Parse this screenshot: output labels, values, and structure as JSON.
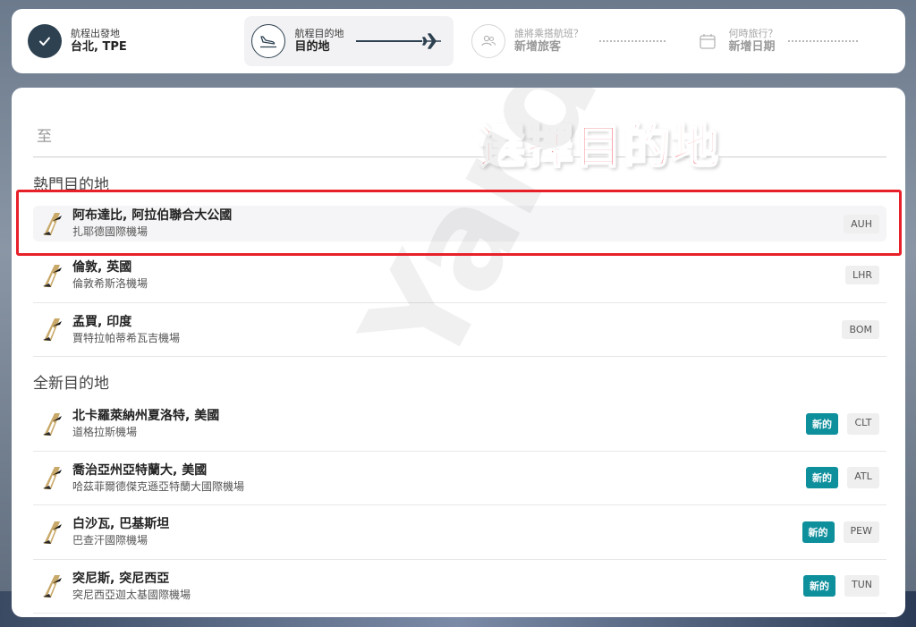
{
  "stepper": {
    "origin": {
      "label": "航程出發地",
      "value": "台北, TPE"
    },
    "destination": {
      "label": "航程目的地",
      "value": "目的地"
    },
    "passengers": {
      "label": "誰將乘搭航班？",
      "value": "新增旅客"
    },
    "date": {
      "label": "何時旅行？",
      "value": "新增日期"
    }
  },
  "search": {
    "placeholder": "至"
  },
  "annotation": {
    "text": "選擇目的地"
  },
  "popular": {
    "title": "熱門目的地",
    "items": [
      {
        "city": "阿布達比, 阿拉伯聯合大公國",
        "airport": "扎耶德國際機場",
        "code": "AUH"
      },
      {
        "city": "倫敦, 英國",
        "airport": "倫敦希斯洛機場",
        "code": "LHR"
      },
      {
        "city": "孟買, 印度",
        "airport": "賈特拉帕蒂希瓦吉機場",
        "code": "BOM"
      }
    ]
  },
  "new_destinations": {
    "title": "全新目的地",
    "new_badge": "新的",
    "items": [
      {
        "city": "北卡羅萊納州夏洛特, 美國",
        "airport": "道格拉斯機場",
        "code": "CLT"
      },
      {
        "city": "喬治亞州亞特蘭大, 美國",
        "airport": "哈茲菲爾德傑克遜亞特蘭大國際機場",
        "code": "ATL"
      },
      {
        "city": "白沙瓦, 巴基斯坦",
        "airport": "巴查汗國際機場",
        "code": "PEW"
      },
      {
        "city": "突尼斯, 突尼西亞",
        "airport": "突尼西亞迦太基國際機場",
        "code": "TUN"
      }
    ]
  },
  "colors": {
    "accent": "#2d4150",
    "new_badge": "#0e8f9c",
    "annotation": "#e8202a"
  },
  "watermark": {
    "text": "Yardingwa"
  }
}
